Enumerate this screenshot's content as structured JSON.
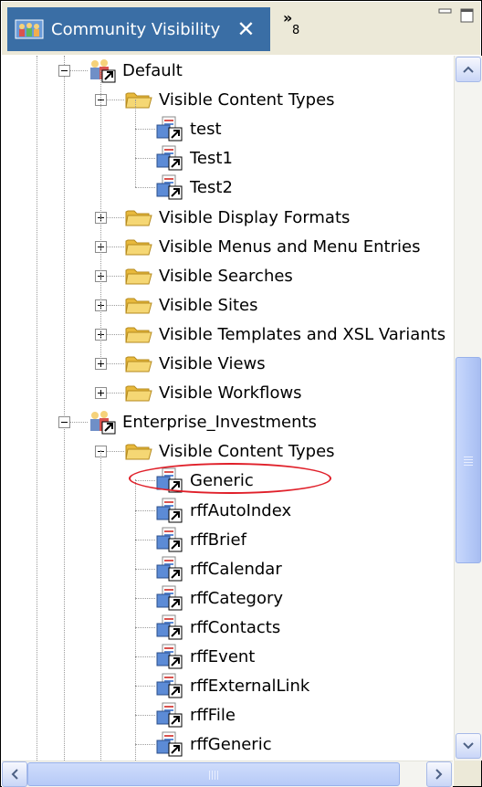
{
  "view": {
    "title": "Community Visibility",
    "hidden_views_count": "8",
    "overflow_glyph": "»"
  },
  "tree": {
    "communities": [
      {
        "label": "Default",
        "expanded": true,
        "folders": [
          {
            "label": "Visible Content Types",
            "expanded": true,
            "items": [
              "test",
              "Test1",
              "Test2"
            ]
          },
          {
            "label": "Visible Display Formats",
            "expanded": false
          },
          {
            "label": "Visible Menus and Menu Entries",
            "expanded": false
          },
          {
            "label": "Visible Searches",
            "expanded": false
          },
          {
            "label": "Visible Sites",
            "expanded": false
          },
          {
            "label": "Visible Templates and XSL Variants",
            "expanded": false
          },
          {
            "label": "Visible Views",
            "expanded": false
          },
          {
            "label": "Visible Workflows",
            "expanded": false
          }
        ]
      },
      {
        "label": "Enterprise_Investments",
        "expanded": true,
        "folders": [
          {
            "label": "Visible Content Types",
            "expanded": true,
            "items": [
              "Generic",
              "rffAutoIndex",
              "rffBrief",
              "rffCalendar",
              "rffCategory",
              "rffContacts",
              "rffEvent",
              "rffExternalLink",
              "rffFile",
              "rffGeneric"
            ]
          }
        ]
      }
    ]
  },
  "annotation": {
    "highlighted_item": "Generic",
    "color": "#e0202a"
  },
  "colors": {
    "tab_active": "#3a6ea5",
    "chrome": "#ece9d8",
    "folder": "#f2c94c"
  }
}
